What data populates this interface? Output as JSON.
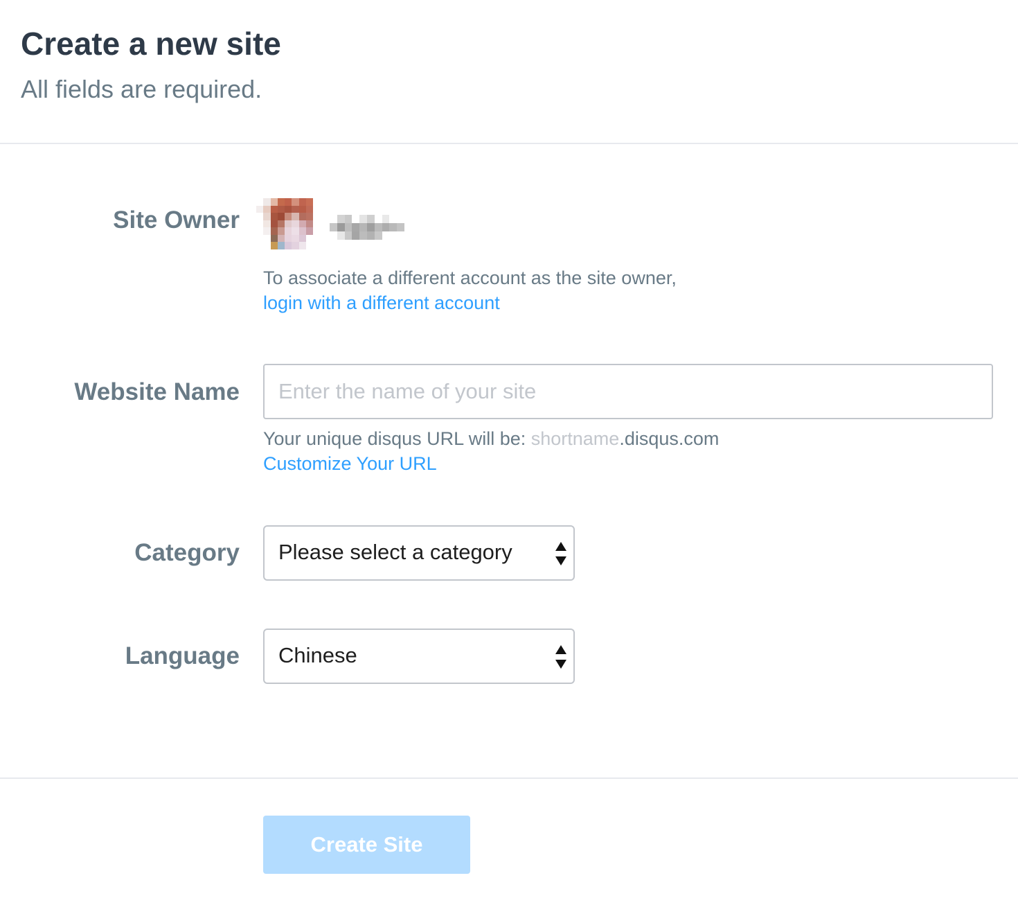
{
  "header": {
    "title": "Create a new site",
    "subtitle": "All fields are required."
  },
  "site_owner": {
    "label": "Site Owner",
    "avatar_icon": "pixelated-avatar-icon",
    "help_text": "To associate a different account as the site owner,",
    "login_link": "login with a different account"
  },
  "website_name": {
    "label": "Website Name",
    "placeholder": "Enter the name of your site",
    "value": "",
    "url_prefix": "Your unique disqus URL will be: ",
    "url_shortname": "shortname",
    "url_suffix": ".disqus.com",
    "customize_link": "Customize Your URL"
  },
  "category": {
    "label": "Category",
    "selected": "Please select a category",
    "arrows_icon": "select-arrows-icon"
  },
  "language": {
    "label": "Language",
    "selected": "Chinese",
    "arrows_icon": "select-arrows-icon"
  },
  "footer": {
    "create_button_label": "Create Site",
    "create_button_disabled": true
  },
  "colors": {
    "title": "#2e3a48",
    "label": "#687a86",
    "link": "#2e9fff",
    "button_disabled_bg": "#b3dcff",
    "border": "#c2c6cc",
    "divider": "#e7e9ee"
  }
}
